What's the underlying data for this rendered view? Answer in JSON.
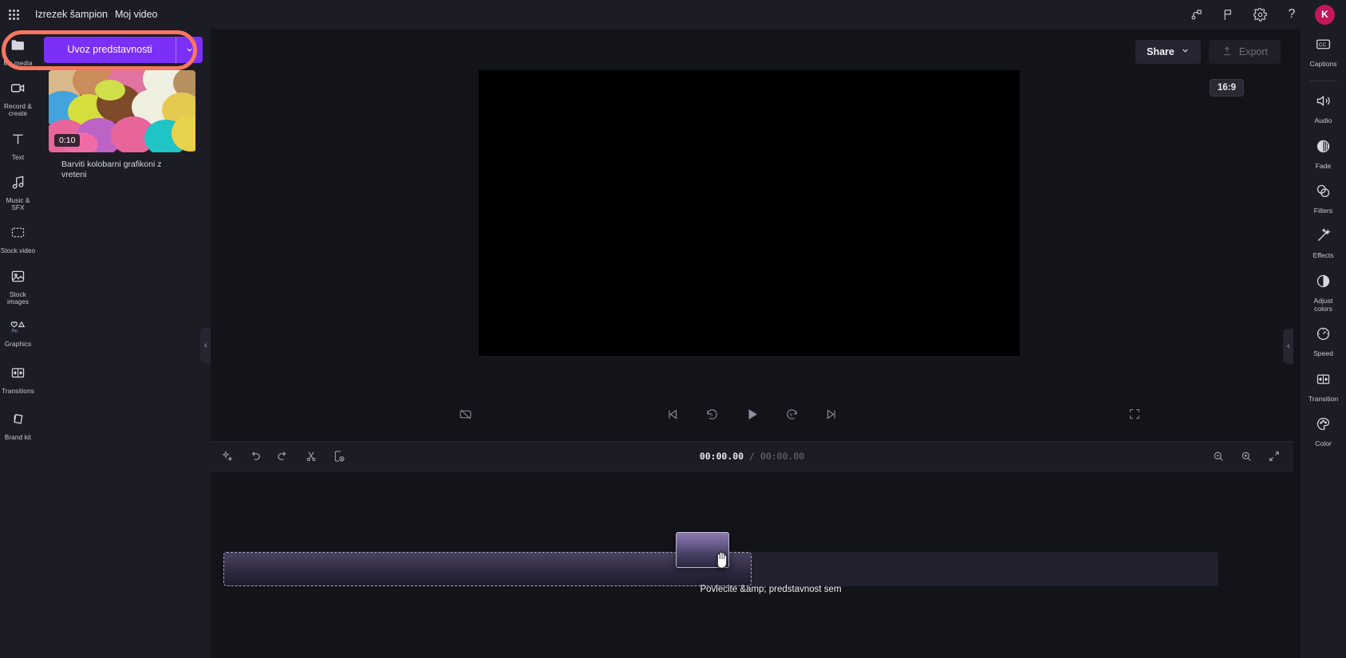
{
  "header": {
    "app_menu_icon": "waffle-grid-icon",
    "project_label": "Izrezek šampion",
    "project_name": "Moj video",
    "icons": [
      {
        "name": "branch-share-icon",
        "glyph": "branch"
      },
      {
        "name": "flag-icon",
        "glyph": "flag"
      },
      {
        "name": "gear-icon",
        "glyph": "gear"
      },
      {
        "name": "help-icon",
        "glyph": "?"
      }
    ],
    "avatar_initial": "K",
    "avatar_color": "#c2185b"
  },
  "left_rail": {
    "items": [
      {
        "label": "My media",
        "icon": "folder-icon",
        "name": "my-media"
      },
      {
        "label": "Record &\ncreate",
        "icon": "video-camera-icon",
        "name": "record-create"
      },
      {
        "label": "Text",
        "icon": "text-t-icon",
        "name": "text"
      },
      {
        "label": "Music & SFX",
        "icon": "music-note-icon",
        "name": "music-sfx"
      },
      {
        "label": "Stock video",
        "icon": "film-strip-icon",
        "name": "stock-video"
      },
      {
        "label": "Stock\nimages",
        "icon": "image-icon",
        "name": "stock-images"
      },
      {
        "label": "Graphics",
        "icon": "shapes-icon",
        "name": "graphics"
      },
      {
        "label": "Transitions",
        "icon": "transition-icon",
        "name": "transitions"
      },
      {
        "label": "Brand kit",
        "icon": "brand-kit-icon",
        "name": "brand-kit"
      }
    ]
  },
  "media_panel": {
    "import_button": {
      "label": "Uvoz predstavnosti",
      "caret_icon": "chevron-down-icon",
      "color": "#7b2ff7"
    },
    "media_item": {
      "duration": "0:10",
      "caption": "Barviti kolobarni grafikoni z vreteni"
    },
    "collapse_icon": "chevron-left-icon"
  },
  "stage": {
    "share_button": {
      "label": "Share",
      "caret_icon": "chevron-down-icon"
    },
    "export_button": {
      "label": "Export",
      "icon": "upload-arrow-icon",
      "disabled": true
    },
    "aspect_ratio": "16:9",
    "player_controls": [
      {
        "name": "captions-off-icon",
        "position": "left"
      },
      {
        "name": "skip-to-start-icon",
        "position": "center"
      },
      {
        "name": "rewind-5s-icon",
        "position": "center"
      },
      {
        "name": "play-icon",
        "position": "center"
      },
      {
        "name": "forward-5s-icon",
        "position": "center"
      },
      {
        "name": "skip-to-end-icon",
        "position": "center"
      },
      {
        "name": "fullscreen-icon",
        "position": "right"
      }
    ]
  },
  "timeline": {
    "toolbar_icons": [
      {
        "name": "magic-sparkle-icon"
      },
      {
        "name": "undo-icon"
      },
      {
        "name": "redo-icon"
      },
      {
        "name": "split-scissors-icon"
      },
      {
        "name": "add-page-icon"
      }
    ],
    "timecode": {
      "current": "00:00.00",
      "separator": "/",
      "total": "00:00.00"
    },
    "zoom_icons": [
      {
        "name": "zoom-out-icon"
      },
      {
        "name": "zoom-in-icon"
      },
      {
        "name": "fit-to-screen-icon"
      }
    ],
    "drop_label": "Povlecite &amp; predstavnost sem",
    "collapse_icon": "chevron-left-icon"
  },
  "right_rail": {
    "items": [
      {
        "label": "Captions",
        "icon": "cc-icon",
        "name": "captions"
      },
      {
        "label": "Audio",
        "icon": "speaker-icon",
        "name": "audio"
      },
      {
        "label": "Fade",
        "icon": "fade-icon",
        "name": "fade"
      },
      {
        "label": "Filters",
        "icon": "filters-icon",
        "name": "filters"
      },
      {
        "label": "Effects",
        "icon": "magic-wand-icon",
        "name": "effects"
      },
      {
        "label": "Adjust\ncolors",
        "icon": "half-circle-icon",
        "name": "adjust-colors"
      },
      {
        "label": "Speed",
        "icon": "speedometer-icon",
        "name": "speed"
      },
      {
        "label": "Transition",
        "icon": "transition-icon",
        "name": "transition"
      },
      {
        "label": "Color",
        "icon": "palette-icon",
        "name": "color"
      }
    ]
  },
  "highlight": {
    "color": "#f8765f"
  }
}
